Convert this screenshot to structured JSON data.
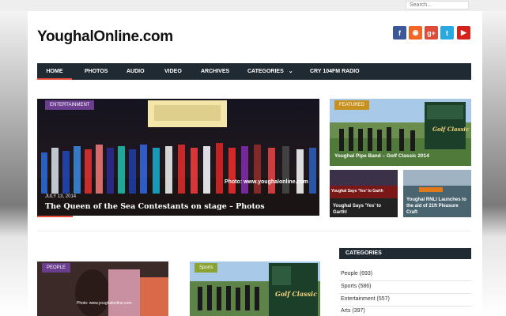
{
  "search": {
    "placeholder": "Search..."
  },
  "site": {
    "title": "YoughalOnline.com"
  },
  "social": [
    {
      "icon": "facebook-icon",
      "glyph": "f",
      "color": "#3b5998"
    },
    {
      "icon": "rss-icon",
      "glyph": "◉",
      "color": "#f26522"
    },
    {
      "icon": "google-plus-icon",
      "glyph": "g+",
      "color": "#dd4b39"
    },
    {
      "icon": "twitter-icon",
      "glyph": "t",
      "color": "#29a9e1"
    },
    {
      "icon": "youtube-icon",
      "glyph": "▶",
      "color": "#d6221b"
    }
  ],
  "nav": {
    "items": [
      "HOME",
      "PHOTOS",
      "AUDIO",
      "VIDEO",
      "ARCHIVES",
      "CATEGORIES",
      "CRY 104FM RADIO"
    ],
    "chevron_icon": "chevron-down-icon"
  },
  "slider": {
    "tag": "ENTERTAINMENT",
    "date": "JULY 13, 2014",
    "title": "The Queen of the Sea Contestants on stage – Photos",
    "watermark": "Photo: www.youghalonline.com"
  },
  "featured": {
    "tag": "FEATURED",
    "main_title": "Youghal Pipe Band – Golf Classic 2014",
    "sub1_title": "Youghal Says 'Yes' to Garth!",
    "sub1_banner": "Youghal Says 'Yes' to Garth",
    "sub2_title": "Youghal RNLI Launches to the aid of 21ft Pleasure Craft"
  },
  "posts": [
    {
      "tag": "PEOPLE",
      "tag_color": "#6a3d8f",
      "watermark": "Photo: www.youghalonline.com"
    },
    {
      "tag": "Sports",
      "tag_color": "#8aa332",
      "sign": "Golf Classic"
    }
  ],
  "categories": {
    "heading": "CATEGORIES",
    "items": [
      "People (693)",
      "Sports (586)",
      "Entertainment (557)",
      "Arts (397)"
    ]
  }
}
